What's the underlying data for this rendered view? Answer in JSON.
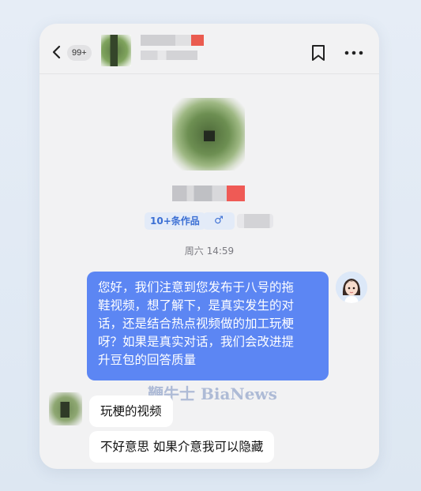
{
  "header": {
    "back_badge": "99+",
    "icons": [
      "back-icon",
      "bookmark-icon",
      "more-icon"
    ]
  },
  "profile": {
    "works_tag": "10+条作品",
    "gender_symbol": "♂"
  },
  "chat": {
    "timestamp": "周六 14:59",
    "messages": [
      {
        "from": "me",
        "lines": [
          "您好，我们注意到您发布于八号的拖",
          "鞋视频，想了解下，是真实发生的对",
          "话，还是结合热点视频做的加工玩梗",
          "呀？如果是真实对话，我们会改进提",
          "升豆包的回答质量"
        ]
      },
      {
        "from": "other",
        "text": "玩梗的视频"
      },
      {
        "from": "other",
        "text": "不好意思 如果介意我可以隐藏"
      }
    ]
  },
  "watermark": "鞭牛士 BiaNews",
  "colors": {
    "accent": "#5c86f3",
    "tag_text": "#3b6fd4",
    "card_bg": "#f2f2f3"
  }
}
